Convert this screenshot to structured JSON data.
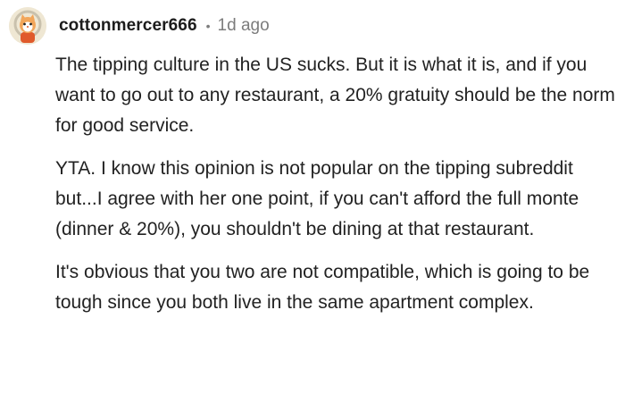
{
  "comment": {
    "author": "cottonmercer666",
    "separator": "•",
    "timestamp": "1d ago",
    "avatar_icon": "cat-avatar-icon",
    "paragraphs": [
      "The tipping culture in the US sucks. But it is what it is, and if you want to go out to any restaurant, a 20% gratuity should be the norm for good service.",
      "YTA. I know this opinion is not popular on the tipping subreddit but...I agree with her one point, if you can't afford the full monte (dinner & 20%), you shouldn't be dining at that restaurant.",
      "It's obvious that you two are not compatible, which is going to be tough since you both live in the same apartment complex."
    ]
  },
  "colors": {
    "text": "#222222",
    "muted": "#7c7c7c",
    "background": "#ffffff"
  }
}
